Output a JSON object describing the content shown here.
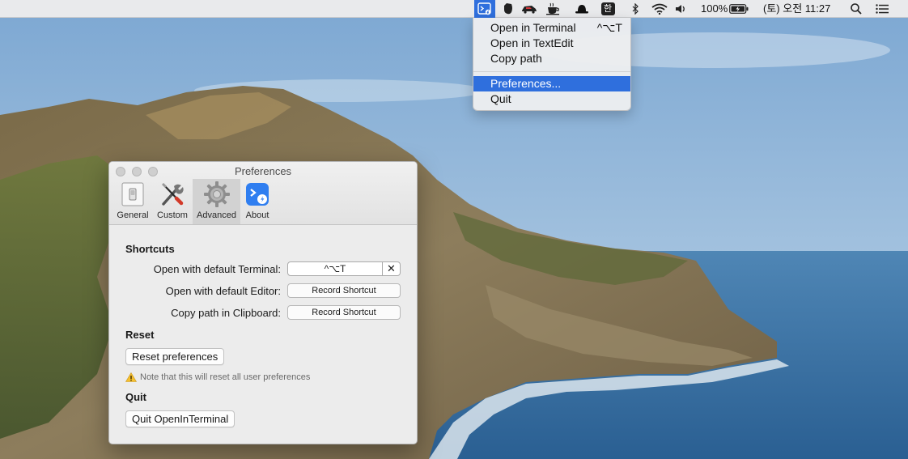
{
  "menubar": {
    "battery_percent": "100%",
    "input_lang": "한",
    "datetime": "(토) 오전 11:27"
  },
  "status_menu": {
    "items": [
      {
        "label": "Open in Terminal",
        "shortcut": "^⌥T"
      },
      {
        "label": "Open in TextEdit",
        "shortcut": ""
      },
      {
        "label": "Copy path",
        "shortcut": ""
      }
    ],
    "preferences": "Preferences...",
    "quit": "Quit"
  },
  "prefs": {
    "title": "Preferences",
    "tabs": [
      {
        "label": "General",
        "icon": "switch-icon"
      },
      {
        "label": "Custom",
        "icon": "tools-icon"
      },
      {
        "label": "Advanced",
        "icon": "gear-icon"
      },
      {
        "label": "About",
        "icon": "app-icon"
      }
    ],
    "active_tab": "Advanced",
    "shortcuts": {
      "heading": "Shortcuts",
      "terminal_label": "Open with default Terminal:",
      "terminal_value": "^⌥T",
      "editor_label": "Open with default Editor:",
      "editor_button": "Record Shortcut",
      "copy_label": "Copy path in Clipboard:",
      "copy_button": "Record Shortcut"
    },
    "reset": {
      "heading": "Reset",
      "button": "Reset preferences",
      "note": "Note that this will reset all user preferences"
    },
    "quit": {
      "heading": "Quit",
      "button": "Quit OpenInTerminal"
    }
  },
  "colors": {
    "accent": "#2f6fdd",
    "window_bg": "#ececec",
    "menubar_bg": "#e9eaec"
  }
}
